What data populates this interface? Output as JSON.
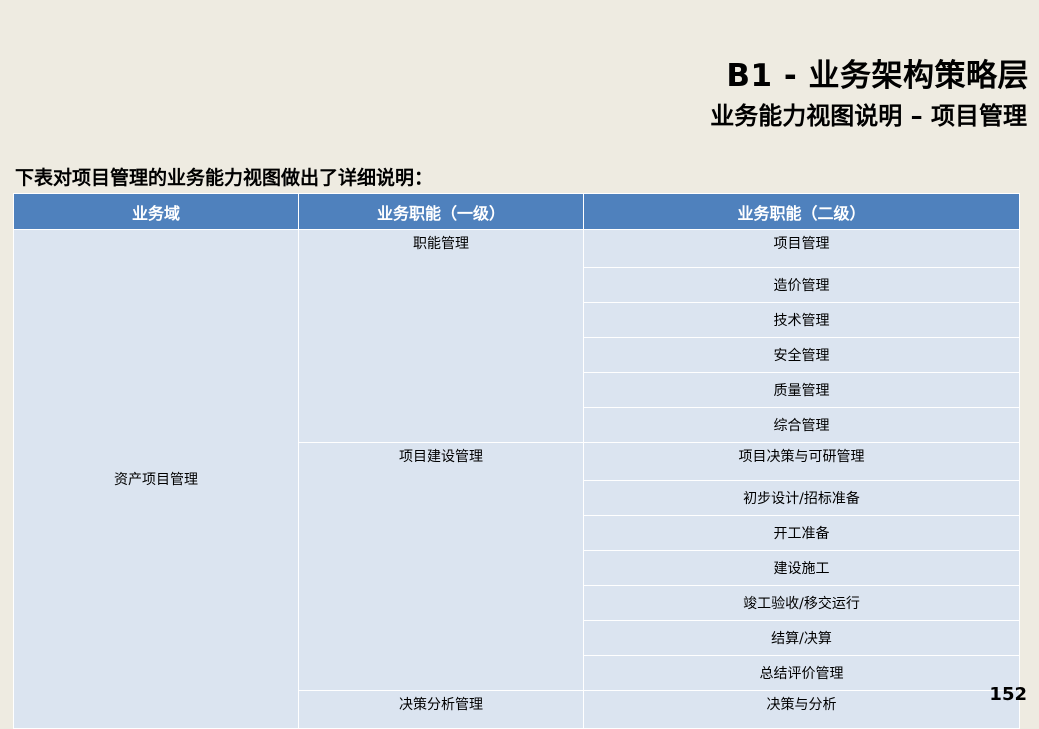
{
  "header": {
    "title": "B1 - 业务架构策略层",
    "subtitle": "业务能力视图说明 – 项目管理"
  },
  "intro": "下表对项目管理的业务能力视图做出了详细说明：",
  "table": {
    "columns": [
      "业务域",
      "业务职能（一级）",
      "业务职能（二级）"
    ],
    "domain": "资产项目管理",
    "level1": [
      "职能管理",
      "项目建设管理",
      "决策分析管理"
    ],
    "level2": [
      "项目管理",
      "造价管理",
      "技术管理",
      "安全管理",
      "质量管理",
      "综合管理",
      "项目决策与可研管理",
      "初步设计/招标准备",
      "开工准备",
      "建设施工",
      "竣工验收/移交运行",
      "结算/决算",
      "总结评价管理",
      "决策与分析"
    ]
  },
  "page_number": "152"
}
